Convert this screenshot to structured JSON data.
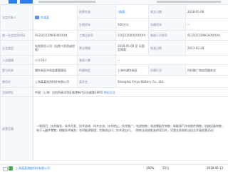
{
  "colors": {
    "accent": "#2f80ed",
    "label_bg": "#f5f8fd",
    "border": "#e6e9ef"
  },
  "rows": {
    "r1": {
      "label_a": "法定代表人",
      "value_a": "李某某",
      "label_b": "经营状态",
      "value_b": "存续",
      "label_c": "成立日期",
      "value_c": "2018-05-08"
    },
    "r2": {
      "label_b": "注册资本",
      "value_b": "500万元",
      "label_c": "实缴资本",
      "value_c": "--"
    },
    "r3": {
      "label_a": "统一社会信用代码",
      "value_a": "91310115MA1HXXXX4",
      "label_b": "工商注册号",
      "value_b": "310115000XXXXXX",
      "label_c": "纳税人识别号",
      "value_c": "91310115MA1HXXXX4"
    },
    "r4": {
      "label_a": "企业类型",
      "value_a": "有限责任公司（自然人投资或控股）",
      "label_b": "营业期限",
      "value_b": "2018-05-08 至 无固定期限",
      "label_c": "核准日期",
      "value_c": "2023-03-28"
    },
    "r5": {
      "label_a": "人员规模",
      "value_a": "小于50人",
      "label_b": "参保人数",
      "value_b": "--"
    },
    "r6": {
      "label_a": "登记机关",
      "value_a": "浦东新区市场监督管理局",
      "label_b": "所属地区",
      "value_b": "上海市浦东新区",
      "label_c": "所属行业",
      "value_c": "科技推广和应用服务业"
    },
    "r7": {
      "label_a": "曾用名",
      "value_a": "上海某某电池科技有限公司",
      "label_b": "英文名",
      "value_b": "Shanghai Xinyu Battery Co., Ltd."
    },
    "r8": {
      "label_a": "注册地址",
      "value_a": "中国（上海）自由贸易试验区临港新片区业盛路188号",
      "link": "附近企业"
    },
    "r9": {
      "label_a": "经营范围",
      "text": "一般项目：技术服务、技术开发、技术咨询、技术交流、技术转让、技术推广；电池销售；电池零配件销售；新能源汽车电附件销售；机械设备销售；电子元器件零售；储能技术服务；合同能源管理；货物进出口；技术进出口。（除依法须经批准的项目外，凭营业执照依法自主开展经营活动）"
    }
  },
  "bottom": {
    "name": "上海某某储能科技有限公司",
    "percent": "100%",
    "amount": "50万",
    "date": "2018-06-12"
  }
}
